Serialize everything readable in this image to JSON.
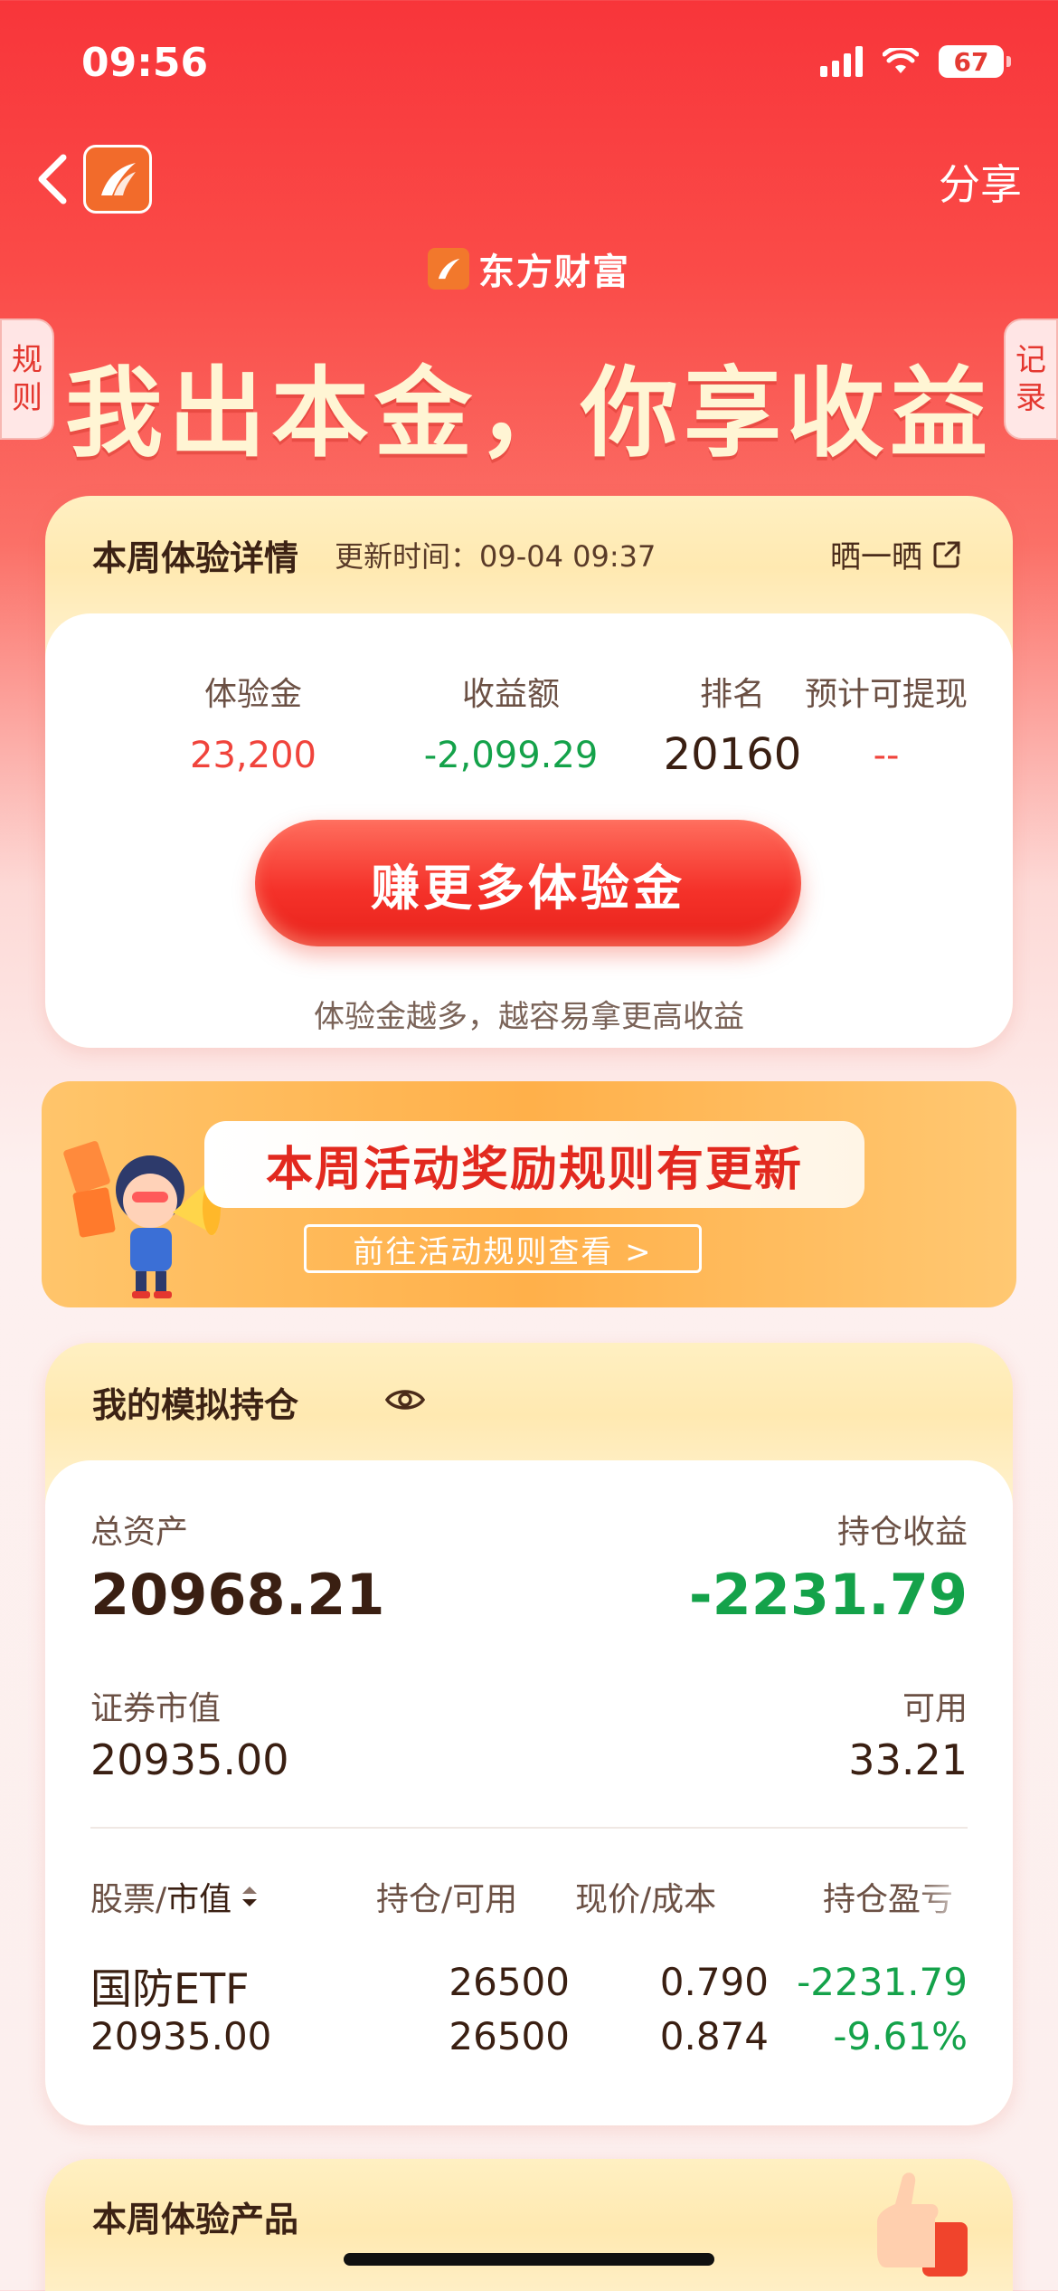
{
  "status_bar": {
    "time": "09:56",
    "battery": "67"
  },
  "nav": {
    "share_label": "分享"
  },
  "brand": {
    "name": "东方财富"
  },
  "side_tabs": {
    "rules": [
      "规",
      "则"
    ],
    "records": [
      "记",
      "录"
    ]
  },
  "headline": "我出本金，你享收益",
  "week_card": {
    "title": "本周体验详情",
    "update_time": "更新时间：09-04 09:37",
    "show_label": "晒一晒",
    "stats": [
      {
        "label": "体验金",
        "value": "23,200",
        "color": "#f0443c"
      },
      {
        "label": "收益额",
        "value": "-2,099.29",
        "color": "#14a24a"
      },
      {
        "label": "排名",
        "value": "20160",
        "color": "#3a1f12"
      },
      {
        "label": "预计可提现",
        "value": "--",
        "color": "#f0443c"
      }
    ],
    "earn_button": "赚更多体验金",
    "hint": "体验金越多，越容易拿更高收益"
  },
  "banner": {
    "title": "本周活动奖励规则有更新",
    "link": "前往活动规则查看 >"
  },
  "positions": {
    "title": "我的模拟持仓",
    "total_assets_label": "总资产",
    "total_assets": "20968.21",
    "holding_profit_label": "持仓收益",
    "holding_profit": "-2231.79",
    "market_value_label": "证券市值",
    "market_value": "20935.00",
    "available_label": "可用",
    "available": "33.21",
    "headers": {
      "stock_prefix": "股票/",
      "stock_sort": "市值",
      "hold": "持仓/可用",
      "price": "现价/成本",
      "pnl": "持仓盈亏"
    },
    "rows": [
      {
        "name": "国防ETF",
        "market_value": "20935.00",
        "hold": "26500",
        "available": "26500",
        "price": "0.790",
        "cost": "0.874",
        "pnl": "-2231.79",
        "pnl_pct": "-9.61%"
      }
    ]
  },
  "products": {
    "title": "本周体验产品"
  },
  "colors": {
    "brand_red": "#f5322a",
    "profit_green": "#14a24a"
  }
}
